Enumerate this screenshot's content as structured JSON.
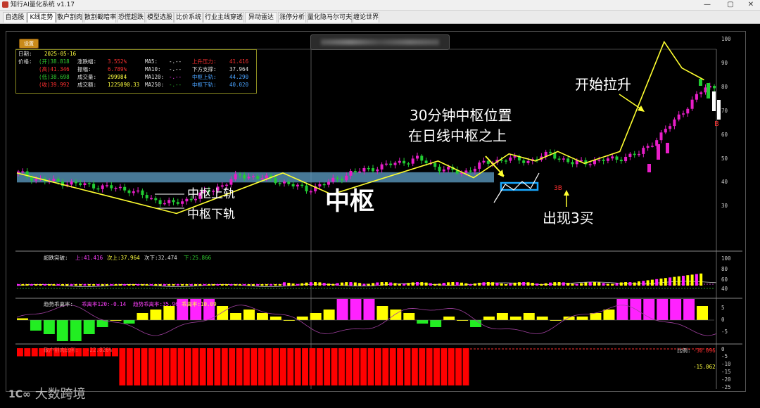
{
  "window": {
    "title": "知行AI量化系统 v1.17",
    "minimize": "—",
    "maximize": "▢",
    "close": "✕"
  },
  "tabs": [
    {
      "label": "自选股",
      "active": false
    },
    {
      "label": "K线走势",
      "active": true
    },
    {
      "label": "散户割肉",
      "active": false
    },
    {
      "label": "散割截暗率",
      "active": false
    },
    {
      "label": "恐慌超跌",
      "active": false
    },
    {
      "label": "模型选股",
      "active": false
    },
    {
      "label": "比价系统",
      "active": false
    },
    {
      "label": "行业主线穿透",
      "active": false
    },
    {
      "label": "异动雷达",
      "active": false
    },
    {
      "label": "涨停分析",
      "active": false
    },
    {
      "label": "量化隐马尔可夫",
      "active": false
    },
    {
      "label": "缠论世界",
      "active": false
    }
  ],
  "toolbar": {
    "settings_label": "设置"
  },
  "info": {
    "date_label": "日期:",
    "date_value": "2025-05-16",
    "price_label": "价格:",
    "open": "(开)38.818",
    "high": "(高)41.346",
    "low": "(低)38.698",
    "close": "(收)39.992",
    "change_pct_label": "涨跌幅:",
    "change_pct_value": "3.552%",
    "amplitude_label": "振幅:",
    "amplitude_value": "6.789%",
    "volume_label": "成交量:",
    "volume_value": "299984",
    "turnover_label": "成交额:",
    "turnover_value": "1225090.33",
    "ma5_label": "MA5:",
    "ma5_value": "-.--",
    "ma10_label": "MA10:",
    "ma10_value": "-.--",
    "ma120_label": "MA120:",
    "ma120_value": "-.--",
    "ma250_label": "MA250:",
    "ma250_value": "-.--",
    "upper_pressure_label": "上升压力:",
    "upper_pressure_value": "41.416",
    "lower_support_label": "下方支撑:",
    "lower_support_value": "37.964",
    "pivot_upper_label": "中枢上轨:",
    "pivot_upper_value": "44.290",
    "pivot_lower_label": "中枢下轨:",
    "pivot_lower_value": "40.020"
  },
  "annotations": {
    "pivot_upper": "中枢上轨",
    "pivot_lower": "中枢下轨",
    "pivot": "中枢",
    "pivot30_line1": "30分钟中枢位置",
    "pivot30_line2": "在日线中枢之上",
    "third_buy": "出现3买",
    "third_buy_marker": "3B",
    "start_rise": "开始拉升",
    "b_marker": "B"
  },
  "main_axis": {
    "ticks": [
      "100",
      "90",
      "80",
      "70",
      "60",
      "50",
      "40",
      "30"
    ],
    "tick_values": [
      100,
      90,
      80,
      70,
      60,
      50,
      40,
      30
    ]
  },
  "panel1": {
    "title": "超跌突破:",
    "up_label": "上:41.416",
    "next_up_label": "次上:37.964",
    "next_down_label": "次下:32.474",
    "down_label": "下:25.866",
    "ticks": [
      "100",
      "80",
      "60",
      "40"
    ]
  },
  "panel2": {
    "title": "趋势乖离率:",
    "ma120_dev": "乖离率120:-0.14",
    "trend_dev": "趋势乖离率:35.96",
    "dev": "乖离率:10.09",
    "ticks": [
      "5",
      "0",
      "-5"
    ]
  },
  "panel3": {
    "title": "散户割肉比例:",
    "title_value": "-22.826%",
    "ratio_label": "比例:",
    "ratio_value": "-30.096",
    "side_value": "-15.062",
    "ticks": [
      "0",
      "-5",
      "-10",
      "-15",
      "-20",
      "-25"
    ]
  },
  "watermark": {
    "logo": "1C∞",
    "text": "大数跨境"
  },
  "colors": {
    "up": "#e81ec8",
    "down": "#22cc33",
    "zigzag": "#ffff30",
    "pivot_band": "#5fa0c8",
    "pivot30_box": "#18a8ff",
    "hist_pos": "#ff22ff",
    "hist_yellow": "#ffff00",
    "hist_neg": "#22ee22",
    "retail_bar": "#ff0000"
  },
  "chart_data": [
    {
      "type": "candlestick",
      "title": "",
      "ylim": [
        20,
        105
      ],
      "x": [
        0,
        5,
        10,
        15,
        20,
        25,
        30,
        35,
        40,
        45,
        50,
        55,
        60,
        65,
        70,
        75,
        80,
        85,
        90,
        95,
        100,
        105,
        110,
        115,
        120,
        125,
        130,
        135,
        140,
        145,
        150,
        155
      ],
      "close": [
        44,
        41,
        40,
        39,
        38,
        37,
        33,
        31,
        34,
        38,
        43,
        42,
        40,
        37,
        40,
        44,
        46,
        48,
        50,
        46,
        44,
        48,
        50,
        49,
        52,
        48,
        49,
        50,
        52,
        60,
        70,
        80
      ],
      "zigzag": {
        "x": [
          0,
          36,
          60,
          71,
          95,
          103,
          111,
          117,
          122,
          128,
          136,
          146,
          150,
          155
        ],
        "y": [
          44,
          27,
          44,
          35,
          49,
          42,
          52,
          49,
          53,
          48,
          53,
          99,
          88,
          83
        ]
      },
      "pivot_band": [
        40.02,
        44.29
      ]
    },
    {
      "type": "bar",
      "title": "趋势乖离率",
      "ylim": [
        -10,
        10
      ],
      "values": [
        0.5,
        -3,
        -4,
        -6,
        -6,
        -4,
        -2,
        0,
        -1,
        2,
        3,
        4,
        6,
        6,
        6,
        4,
        2,
        3,
        2,
        1,
        0,
        1,
        2,
        3,
        6,
        6,
        6,
        4,
        3,
        2,
        -1,
        -2,
        1,
        0,
        -2,
        1,
        2,
        1,
        2,
        1,
        0,
        1,
        1,
        2,
        3,
        6,
        6,
        6,
        6,
        6,
        6,
        4
      ]
    },
    {
      "type": "bar",
      "title": "散户割肉比例",
      "ylim": [
        -26,
        1
      ],
      "values": [
        -5,
        -5,
        -5,
        -5,
        -5,
        -5,
        -5,
        -5,
        -5,
        -5,
        -5,
        -5,
        -5,
        -5,
        -23,
        -23,
        -23,
        -23,
        -23,
        -23,
        -23,
        -23,
        -23,
        -23,
        -23,
        -23,
        -23,
        -23,
        -23,
        -23,
        -23,
        -23,
        -23,
        -23,
        -23,
        -23,
        -23,
        -23,
        -23,
        -23,
        -23,
        -23,
        -23,
        -23,
        -23,
        -23,
        -23,
        -23,
        -23,
        -23,
        -23,
        -23,
        -23,
        -23,
        -23,
        -23,
        -23,
        -23,
        -23,
        -23,
        -23,
        -23
      ]
    }
  ]
}
